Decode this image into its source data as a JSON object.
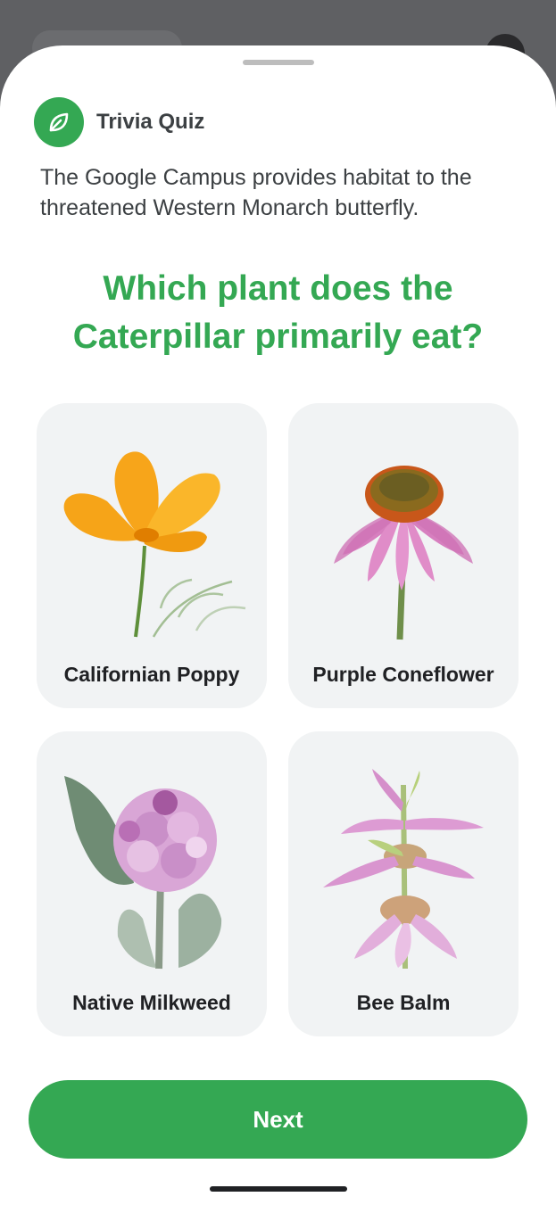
{
  "header": {
    "title": "Trivia Quiz",
    "icon": "leaf-icon"
  },
  "intro_text": "The Google Campus provides habitat to the threatened Western Monarch butterfly.",
  "question": "Which plant does the Caterpillar primarily eat?",
  "options": [
    {
      "label": "Californian Poppy",
      "image": "poppy-image"
    },
    {
      "label": "Purple Coneflower",
      "image": "coneflower-image"
    },
    {
      "label": "Native Milkweed",
      "image": "milkweed-image"
    },
    {
      "label": "Bee Balm",
      "image": "bee-balm-image"
    }
  ],
  "next_button": {
    "label": "Next"
  },
  "colors": {
    "accent": "#34a853",
    "card": "#f1f3f4",
    "text": "#3c4043"
  }
}
